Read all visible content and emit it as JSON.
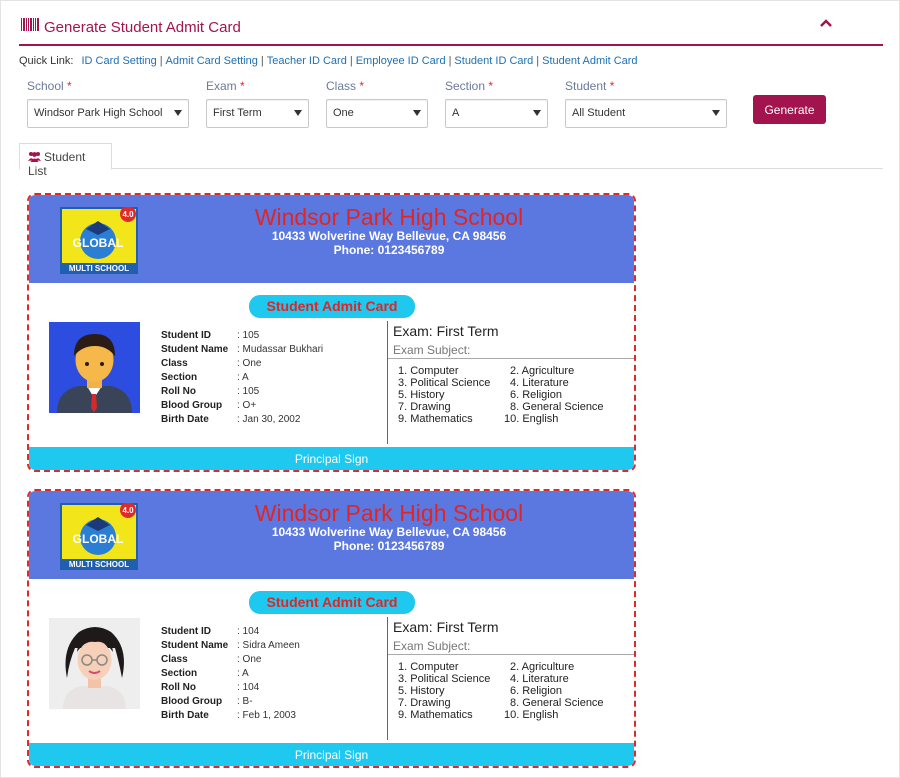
{
  "header": {
    "title": "Generate Student Admit Card"
  },
  "quick_links": {
    "label": "Quick Link:",
    "links": [
      "ID Card Setting",
      "Admit Card Setting",
      "Teacher ID Card",
      "Employee ID Card",
      "Student ID Card",
      "Student Admit Card"
    ]
  },
  "filters": {
    "school": {
      "label": "School",
      "required": "*",
      "value": "Windsor Park High School"
    },
    "exam": {
      "label": "Exam",
      "required": "*",
      "value": "First Term"
    },
    "class": {
      "label": "Class",
      "required": "*",
      "value": "One"
    },
    "section": {
      "label": "Section",
      "required": "*",
      "value": "A"
    },
    "student": {
      "label": "Student",
      "required": "*",
      "value": "All Student"
    },
    "generate_label": "Generate"
  },
  "tabs": [
    {
      "label": "Student List"
    }
  ],
  "card_common": {
    "school_name": "Windsor Park High School",
    "address": "10433 Wolverine Way Bellevue, CA 98456",
    "phone": "Phone: 0123456789",
    "card_title": "Student Admit Card",
    "exam": "Exam: First Term",
    "exam_subject_label": "Exam Subject:",
    "footer": "Principal Sign",
    "logo_text": {
      "top": "GLOBAL",
      "bottom": "MULTI SCHOOL",
      "badge": "4.0"
    },
    "field_labels": {
      "student_id": "Student ID",
      "student_name": "Student Name",
      "class": "Class",
      "section": "Section",
      "roll_no": "Roll No",
      "blood_group": "Blood Group",
      "birth_date": "Birth Date"
    },
    "subjects_left": [
      "1. Computer",
      "3. Political Science",
      "5. History",
      "7. Drawing",
      "9. Mathematics"
    ],
    "subjects_right": [
      "2. Agriculture",
      "4. Literature",
      "6. Religion",
      "8. General Science",
      "10. English"
    ]
  },
  "cards": [
    {
      "student_id": ": 105",
      "student_name": ": Mudassar Bukhari",
      "class": ": One",
      "section": ": A",
      "roll_no": ": 105",
      "blood_group": ": O+",
      "birth_date": ": Jan 30, 2002"
    },
    {
      "student_id": ": 104",
      "student_name": ": Sidra Ameen",
      "class": ": One",
      "section": ": A",
      "roll_no": ": 104",
      "blood_group": ": B-",
      "birth_date": ": Feb 1, 2003"
    }
  ],
  "colors": {
    "brand": "#a3144e",
    "card_header": "#5b78e0",
    "card_accent": "#1ec8ee",
    "school_name": "#e32424",
    "link": "#1f6fb2"
  }
}
